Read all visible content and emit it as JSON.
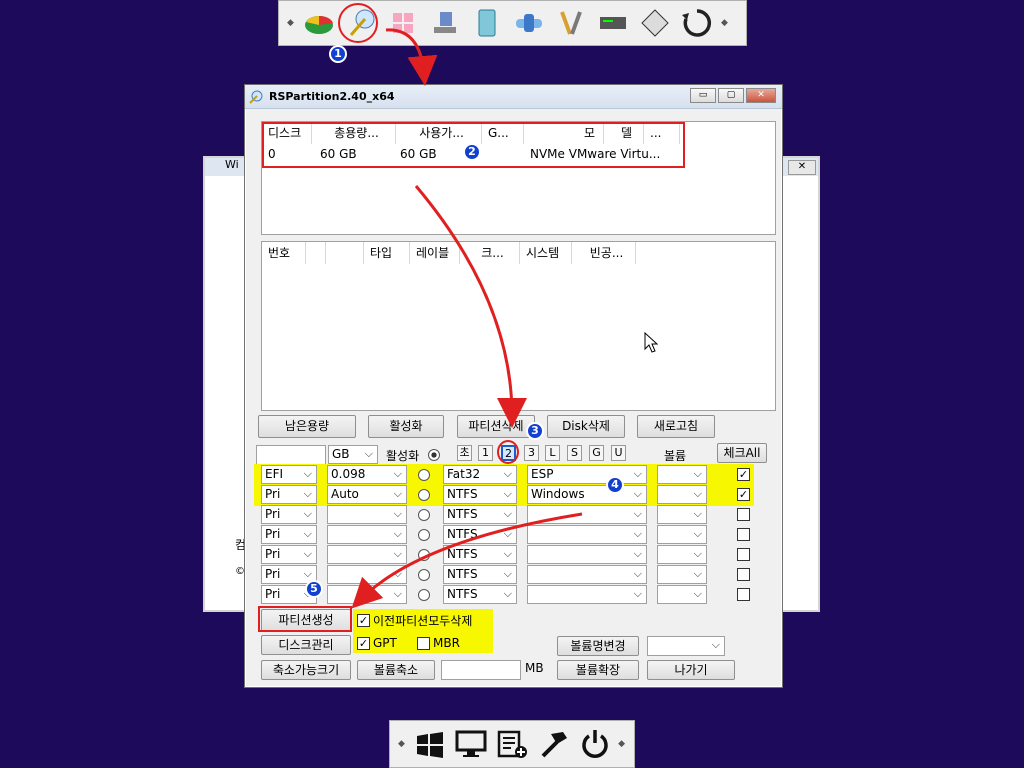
{
  "window": {
    "title": "RSPartition2.40_x64",
    "bg_title": "Wi",
    "bg_side_a": "컴",
    "bg_side_b": "©"
  },
  "disk_list": {
    "headers": [
      "디스크",
      "총용량...",
      "사용가...",
      "G...",
      "모",
      "델",
      "..."
    ],
    "rows": [
      [
        "0",
        "60 GB",
        "60 GB",
        "",
        "NVMe VMware Virtu..."
      ]
    ]
  },
  "partition_list": {
    "headers": [
      "번호",
      "",
      "",
      "타입",
      "레이블",
      "크...",
      "시스템",
      "빈공..."
    ]
  },
  "buttons": {
    "free_space": "남은용량",
    "activate": "활성화",
    "delete_partition": "파티션삭제",
    "delete_disk": "Disk삭제",
    "refresh": "새로고침",
    "create_partition": "파티션생성",
    "disk_manage": "디스크관리",
    "shrinkable_size": "축소가능크기",
    "volume_shrink": "볼륨축소",
    "volume_extend": "볼륨확장",
    "exit": "나가기",
    "rename_volume": "볼륨명변경"
  },
  "controls": {
    "unit": "GB",
    "active_label": "활성화",
    "count_buttons": [
      "초",
      "1",
      "2",
      "3",
      "L",
      "S",
      "G",
      "U"
    ],
    "volume_label": "볼륨",
    "check_all": "체크All",
    "delete_all_prev": "이전파티션모두삭제",
    "gpt": "GPT",
    "mbr": "MBR",
    "mb_unit": "MB"
  },
  "partition_rows": [
    {
      "type": "EFI",
      "size": "0.098",
      "fs": "Fat32",
      "label": "ESP",
      "checked": true
    },
    {
      "type": "Pri",
      "size": "Auto",
      "fs": "NTFS",
      "label": "Windows",
      "checked": true
    },
    {
      "type": "Pri",
      "size": "",
      "fs": "NTFS",
      "label": "",
      "checked": false
    },
    {
      "type": "Pri",
      "size": "",
      "fs": "NTFS",
      "label": "",
      "checked": false
    },
    {
      "type": "Pri",
      "size": "",
      "fs": "NTFS",
      "label": "",
      "checked": false
    },
    {
      "type": "Pri",
      "size": "",
      "fs": "NTFS",
      "label": "",
      "checked": false
    },
    {
      "type": "Pri",
      "size": "",
      "fs": "NTFS",
      "label": "",
      "checked": false
    }
  ],
  "badges": [
    "1",
    "2",
    "3",
    "4",
    "5"
  ],
  "toolbar_top": [
    "pie-chart-icon",
    "wand-icon",
    "windows-tiles-icon",
    "network-icon",
    "book-icon",
    "pipe-icon",
    "tools-icon",
    "drive-icon",
    "floppy-icon",
    "refresh-icon"
  ],
  "toolbar_bottom": [
    "windows-flag-icon",
    "monitor-icon",
    "list-add-icon",
    "hammer-icon",
    "power-icon"
  ],
  "colors": {
    "desktop": "#1e0a5a",
    "highlight": "#f7f700",
    "annotation": "#e02020",
    "badge": "#1240d0"
  }
}
